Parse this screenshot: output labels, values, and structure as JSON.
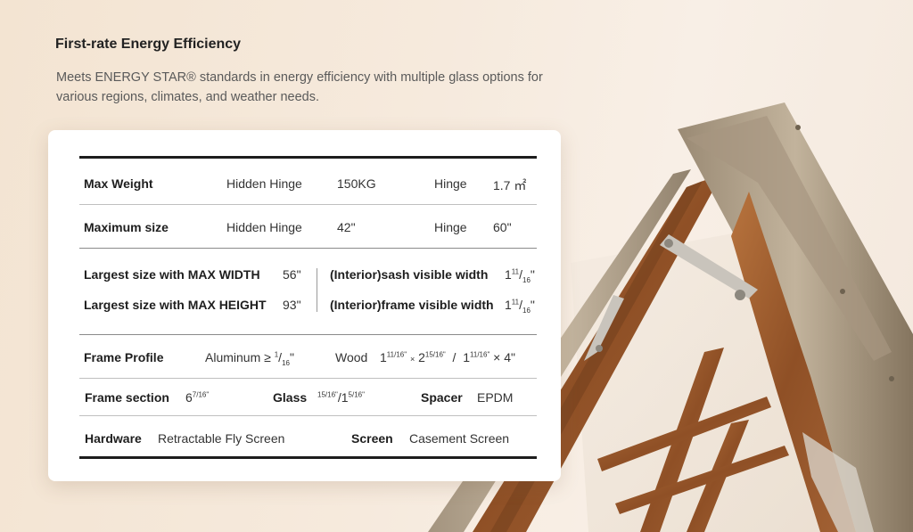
{
  "header": {
    "title": "First-rate Energy Efficiency",
    "description": "Meets ENERGY STAR® standards in energy efficiency with multiple glass options for various regions, climates, and weather needs."
  },
  "specs": {
    "max_weight": {
      "label": "Max Weight",
      "hidden_hinge_label": "Hidden Hinge",
      "hidden_hinge_value": "150KG",
      "hinge_label": "Hinge",
      "hinge_value": "1.7 ㎡"
    },
    "maximum_size": {
      "label": "Maximum size",
      "hidden_hinge_label": "Hidden Hinge",
      "hidden_hinge_value": "42\"",
      "hinge_label": "Hinge",
      "hinge_value": "60\""
    },
    "largest_width": {
      "label": "Largest size with MAX WIDTH",
      "value": "56\""
    },
    "largest_height": {
      "label": "Largest size with MAX HEIGHT",
      "value": "93\""
    },
    "sash_visible": {
      "label": "(Interior)sash visible width",
      "value_whole": "1",
      "value_num": "11",
      "value_den": "16",
      "unit": "\""
    },
    "frame_visible": {
      "label": "(Interior)frame visible width",
      "value_whole": "1",
      "value_num": "11",
      "value_den": "16",
      "unit": "\""
    },
    "frame_profile": {
      "label": "Frame Profile",
      "aluminum": "Aluminum ≥ ",
      "aluminum_num": "1",
      "aluminum_den": "16",
      "aluminum_unit": "\"",
      "wood_label": "Wood",
      "wood_value_a": "1",
      "wood_value_a_frac": "11/16\"",
      "wood_times": "×",
      "wood_value_b": "2",
      "wood_value_b_frac": "15/16\"",
      "slash": "/",
      "wood_value_c": "1",
      "wood_value_c_frac": "11/16\"",
      "wood_value_c_tail": "× 4\""
    },
    "frame_section": {
      "label": "Frame section",
      "value_whole": "6",
      "value_frac": "7/16\"",
      "glass_label": "Glass",
      "glass_value_a": "15/16\"",
      "glass_sep": "/",
      "glass_value_b": "1",
      "glass_value_b_frac": "5/16\"",
      "spacer_label": "Spacer",
      "spacer_value": "EPDM"
    },
    "hardware": {
      "label": "Hardware",
      "value": "Retractable Fly Screen",
      "screen_label": "Screen",
      "screen_value": "Casement Screen"
    }
  }
}
